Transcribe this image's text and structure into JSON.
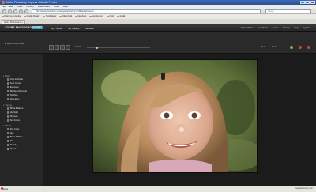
{
  "browser": {
    "title": "Adobe Photoshop Express - Mozilla Firefox",
    "menus": [
      "File",
      "Edit",
      "View",
      "History",
      "Bookmarks",
      "Tools",
      "Help"
    ],
    "url": "http://www.photoshop.com/express/landing.html#flashphotoedit",
    "search_placeholder": "Google",
    "bookmarks": [
      "Welcome to Adobe",
      "Google Reader",
      "SendBlaster",
      "Yahoo Mail",
      "Facebook",
      "Google Docs",
      "Flickr",
      "Gmail"
    ],
    "tab_label": "Adobe Photoshop Ex...",
    "status_left": "Done",
    "status_right": "www.photoshop.com"
  },
  "app": {
    "logo": "ADOBE PHOTOSHOP",
    "badge": "EXPRESS",
    "nav": [
      "My Photos",
      "My Gallery",
      "Browse"
    ],
    "user_links": [
      "Upload Photos",
      "Feedback",
      "Terms",
      "Privacy",
      "Help"
    ],
    "signout": "Sign Out",
    "back_label": "Back to My Photos",
    "zoom_label": "Actions",
    "zoom_level": 0.15,
    "actions": [
      "Undo",
      "Reset"
    ],
    "sections": [
      {
        "title": "Basic",
        "items": [
          "Crop & Rotate",
          "Auto Correct",
          "Exposure",
          "Red-Eye Removal",
          "Touchup",
          "Saturation"
        ]
      },
      {
        "title": "Tuning",
        "items": [
          "White Balance",
          "Highlight",
          "Sharpen",
          "Soft Focus"
        ]
      },
      {
        "title": "Effects",
        "items": [
          "Pop Color",
          "Hue",
          "Black & White",
          "Tint",
          "Sketch",
          "Distort"
        ]
      }
    ],
    "selected_item": "Distort"
  },
  "colors": {
    "accent": "#4aa3c9",
    "app_bg": "#1f1f1f",
    "firefox_title": "#2a4f92"
  },
  "icons": {
    "back": "green-dot-icon",
    "save": "green-circle-icon",
    "cancel": "red-circle-icon"
  }
}
